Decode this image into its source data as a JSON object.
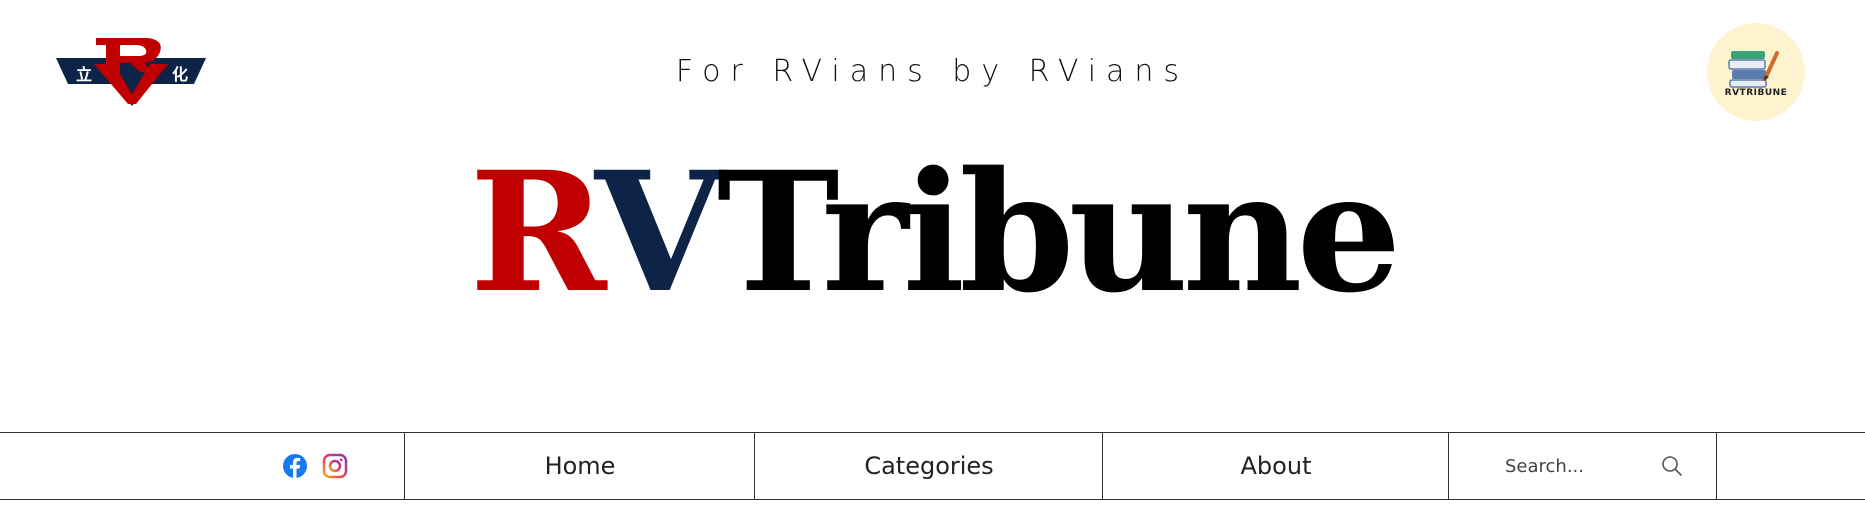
{
  "header": {
    "tagline": "For RVians by RVians",
    "logo_left": {
      "icon": "rv-school-crest-icon",
      "characters": "立 化"
    },
    "logo_right": {
      "icon": "rvtribune-books-logo-icon",
      "text": "RVTRIBUNE"
    }
  },
  "masthead": {
    "part_r": "R",
    "part_v": "V",
    "part_rest": "Tribune"
  },
  "colors": {
    "red": "#c00000",
    "navy": "#0d2347",
    "black": "#000000"
  },
  "nav": {
    "social": [
      {
        "name": "facebook",
        "icon": "facebook-icon"
      },
      {
        "name": "instagram",
        "icon": "instagram-icon"
      }
    ],
    "items": [
      {
        "label": "Home"
      },
      {
        "label": "Categories"
      },
      {
        "label": "About"
      }
    ],
    "search": {
      "placeholder": "Search...",
      "icon": "search-icon"
    }
  }
}
